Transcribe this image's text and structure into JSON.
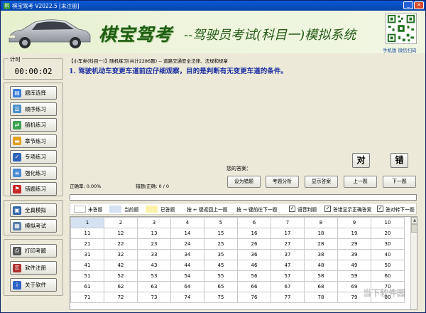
{
  "window": {
    "title": "棋宝驾考 V2022.5 [未注册]",
    "app_icon_text": "棋"
  },
  "banner": {
    "brand": "棋宝驾考",
    "subtitle": "--驾驶员考试(科目一)模拟系统",
    "qr_caption": "手机版 微信扫码"
  },
  "timer": {
    "label": "计时",
    "value": "00:00:02"
  },
  "sidebar": {
    "group1": [
      {
        "label": "题库选择",
        "icon": "book-icon",
        "color": "#3a7bd5"
      },
      {
        "label": "顺序练习",
        "icon": "list-icon",
        "color": "#4a90c8"
      },
      {
        "label": "随机练习",
        "icon": "shuffle-icon",
        "color": "#3aa352"
      },
      {
        "label": "章节练习",
        "icon": "folder-icon",
        "color": "#e0a020"
      },
      {
        "label": "专项练习",
        "icon": "check-icon",
        "color": "#2e63b8"
      },
      {
        "label": "强化练习",
        "icon": "form-icon",
        "color": "#4a8ad0"
      },
      {
        "label": "错题练习",
        "icon": "flag-icon",
        "color": "#c82828"
      }
    ],
    "group2": [
      {
        "label": "全真模拟",
        "icon": "monitor-icon",
        "color": "#3465a8"
      },
      {
        "label": "模拟考试",
        "icon": "document-icon",
        "color": "#5a7fa8"
      }
    ],
    "group3": [
      {
        "label": "打印考题",
        "icon": "printer-icon",
        "color": "#555555"
      },
      {
        "label": "软件注册",
        "icon": "key-icon",
        "color": "#b03030"
      },
      {
        "label": "关于软件",
        "icon": "info-icon",
        "color": "#2e63c8"
      }
    ]
  },
  "question": {
    "breadcrumb": "【小车类(科目一)】随机练习(共计2286题) -- 道路交通安全法律、法规和规章",
    "text": "1. 驾驶机动车变更车道前应仔细观察，目的是判断有无变更车道的条件。"
  },
  "answer": {
    "label": "您的答案：",
    "true_label": "对",
    "false_label": "错"
  },
  "stats": {
    "accuracy": "正确率: 0.00%",
    "counts": "错题/正确: 0 / 0"
  },
  "actions": [
    "设为错题",
    "考题分析",
    "显示答案",
    "上一题",
    "下一题"
  ],
  "legend": {
    "unanswered": "未答题",
    "current": "当前题",
    "answered": "已答题",
    "prev_hint": "按 ← 键返回上一题",
    "next_hint": "按 → 键前往下一题",
    "voice": "语音判题",
    "show_correct": "答错显示正确答案",
    "auto_next": "答对转下一题",
    "colors": {
      "unanswered": "#ffffff",
      "current": "#d6e1f2",
      "answered": "#fcf2a8"
    }
  },
  "grid": {
    "rows": [
      [
        "1",
        "2",
        "3",
        "4",
        "5",
        "6",
        "7",
        "8",
        "9",
        "10"
      ],
      [
        "11",
        "12",
        "13",
        "14",
        "15",
        "16",
        "17",
        "18",
        "19",
        "20"
      ],
      [
        "21",
        "22",
        "23",
        "24",
        "25",
        "26",
        "27",
        "28",
        "29",
        "30"
      ],
      [
        "31",
        "32",
        "33",
        "34",
        "35",
        "36",
        "37",
        "38",
        "39",
        "40"
      ],
      [
        "41",
        "42",
        "43",
        "44",
        "45",
        "46",
        "47",
        "48",
        "49",
        "50"
      ],
      [
        "51",
        "52",
        "53",
        "54",
        "55",
        "56",
        "57",
        "58",
        "59",
        "60"
      ],
      [
        "61",
        "62",
        "63",
        "64",
        "65",
        "66",
        "67",
        "68",
        "69",
        "70"
      ],
      [
        "71",
        "72",
        "73",
        "74",
        "75",
        "76",
        "77",
        "78",
        "79",
        "80"
      ]
    ]
  },
  "watermark": "当下软件园"
}
